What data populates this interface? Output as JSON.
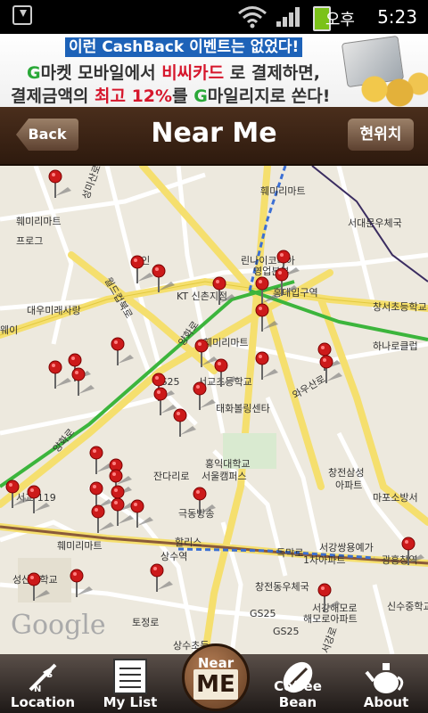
{
  "status_bar": {
    "ampm": "오후",
    "time": "5:23"
  },
  "ad": {
    "line1": "이런 CashBack 이벤트는 없었다!",
    "line2_g": "G",
    "line2_a": "마켓 모바일에서 ",
    "line2_card": "비씨카드",
    "line2_b": " 로 결제하면,",
    "line3_a": "결제금액의 ",
    "line3_pct": "최고 12%",
    "line3_b": "를 ",
    "line3_g": "G",
    "line3_c": "마일리지로 쏜다!"
  },
  "header": {
    "back_label": "Back",
    "title": "Near Me",
    "location_label": "현위치"
  },
  "map": {
    "watermark": "Google",
    "labels": [
      "훼미리마트",
      "훼미리마트",
      "서대문우체국",
      "프로그",
      "대우미래사랑",
      "린나이코리아",
      "영업본부",
      "홍대입구역",
      "KT 신촌지점",
      "창서초등학교",
      "웨이",
      "훼미리마트",
      "하나로클럽",
      "GS25",
      "서교초등학교",
      "태화볼링센타",
      "홍익대학교",
      "서울캠퍼스",
      "창전삼성",
      "아파트",
      "서교 119",
      "잔다리로",
      "극동방송",
      "마포소방서",
      "훼미리마트",
      "할리스",
      "서강쌍용예가",
      "1차아파트",
      "광흥창역",
      "성산중학교",
      "상수역",
      "독막로",
      "창전동우체국",
      "서강해모로",
      "해모로아파트",
      "신수중학교",
      "GS25",
      "토정로",
      "상수초등",
      "성미산로",
      "양화로",
      "와우산로",
      "월드컵북로",
      "양화로",
      "서강로",
      "모인",
      "GS25"
    ]
  },
  "tabs": [
    {
      "label": "Location",
      "icon": "compass-icon"
    },
    {
      "label": "My List",
      "icon": "list-icon"
    },
    {
      "label": "Coffee Bean",
      "icon": "coffee-bean-icon"
    },
    {
      "label": "About",
      "icon": "teapot-icon"
    }
  ],
  "nearme_button": {
    "top": "Near",
    "bottom": "ME"
  },
  "colors": {
    "header_brown": "#3d2516",
    "pin_red": "#cc1a1a",
    "road_yellow": "#f7e98e",
    "subway_green": "#3cb53c",
    "ad_blue": "#1d62b8"
  }
}
